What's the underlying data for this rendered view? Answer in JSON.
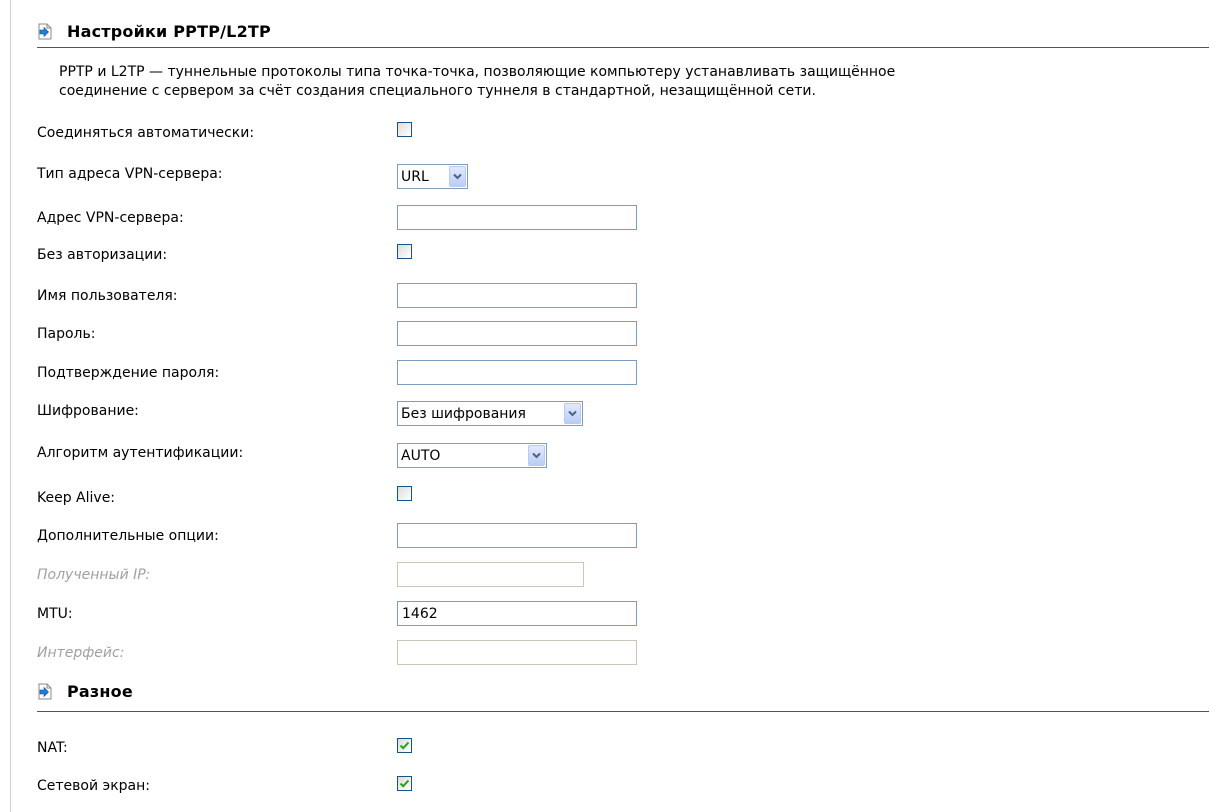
{
  "pptp_section": {
    "title": "Настройки PPTP/L2TP",
    "description_line1": "PPTP и L2TP — туннельные протоколы типа точка-точка, позволяющие компьютеру устанавливать защищённое",
    "description_line2": "соединение с сервером за счёт создания специального туннеля в стандартной, незащищённой сети."
  },
  "fields": {
    "auto_connect": {
      "label": "Соединяться автоматически:",
      "checked": false
    },
    "vpn_address_type": {
      "label": "Тип адреса VPN-сервера:",
      "value": "URL"
    },
    "vpn_server_address": {
      "label": "Адрес VPN-сервера:",
      "value": ""
    },
    "no_auth": {
      "label": "Без авторизации:",
      "checked": false
    },
    "username": {
      "label": "Имя пользователя:",
      "value": ""
    },
    "password": {
      "label": "Пароль:",
      "value": ""
    },
    "password_confirm": {
      "label": "Подтверждение пароля:",
      "value": ""
    },
    "encryption": {
      "label": "Шифрование:",
      "value": "Без шифрования"
    },
    "auth_algorithm": {
      "label": "Алгоритм аутентификации:",
      "value": "AUTO"
    },
    "keep_alive": {
      "label": "Keep Alive:",
      "checked": false
    },
    "extra_options": {
      "label": "Дополнительные опции:",
      "value": ""
    },
    "received_ip": {
      "label": "Полученный IP:",
      "value": ""
    },
    "mtu": {
      "label": "MTU:",
      "value": "1462"
    },
    "interface": {
      "label": "Интерфейс:",
      "value": ""
    }
  },
  "misc_section": {
    "title": "Разное",
    "nat": {
      "label": "NAT:",
      "checked": true
    },
    "firewall": {
      "label": "Сетевой экран:",
      "checked": true
    }
  },
  "icons": {
    "section_icon": "page-arrow-icon",
    "dropdown_icon": "chevron-down-icon",
    "check_icon": "checkmark-icon"
  },
  "colors": {
    "checkmark": "#21a121",
    "input_border": "#7f9db9",
    "disabled_text": "#a0a0a0"
  }
}
